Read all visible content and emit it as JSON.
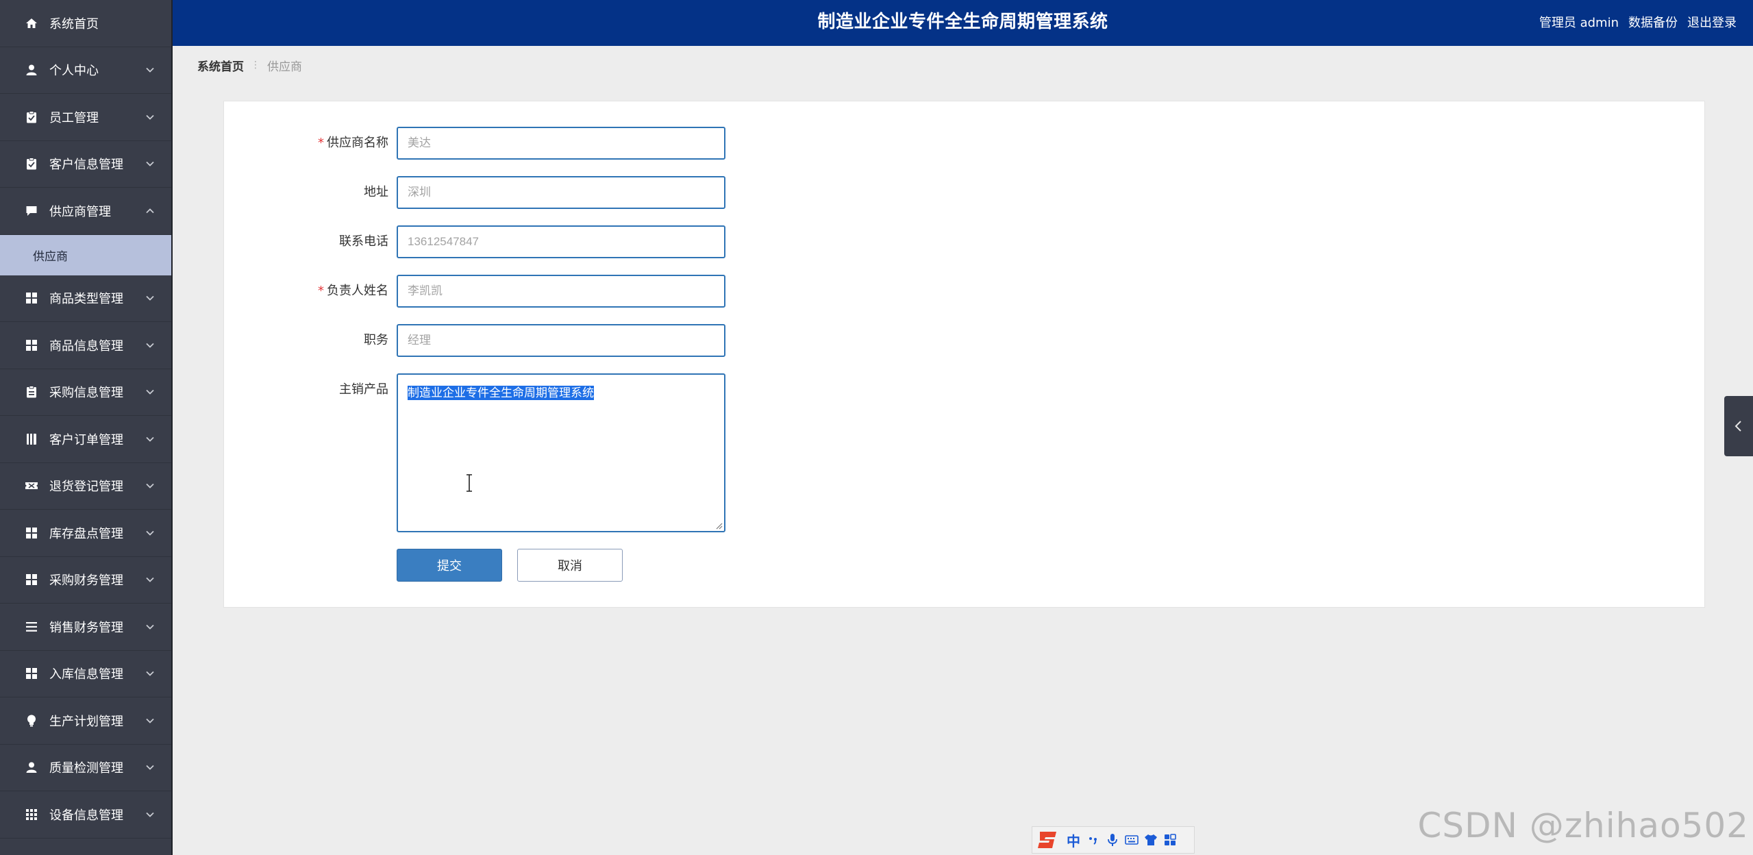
{
  "app": {
    "title": "制造业企业专件全生命周期管理系统"
  },
  "header": {
    "admin_label": "管理员 admin",
    "backup_label": "数据备份",
    "logout_label": "退出登录"
  },
  "sidebar": {
    "items": [
      {
        "label": "系统首页",
        "icon": "home-icon"
      },
      {
        "label": "个人中心",
        "icon": "user-icon"
      },
      {
        "label": "员工管理",
        "icon": "clipboard-icon"
      },
      {
        "label": "客户信息管理",
        "icon": "clipboard-icon"
      },
      {
        "label": "供应商管理",
        "icon": "chat-icon"
      },
      {
        "label": "商品类型管理",
        "icon": "grid-icon"
      },
      {
        "label": "商品信息管理",
        "icon": "grid-icon"
      },
      {
        "label": "采购信息管理",
        "icon": "clipboard-icon"
      },
      {
        "label": "客户订单管理",
        "icon": "book-icon"
      },
      {
        "label": "退货登记管理",
        "icon": "ticket-icon"
      },
      {
        "label": "库存盘点管理",
        "icon": "grid-icon"
      },
      {
        "label": "采购财务管理",
        "icon": "grid-icon"
      },
      {
        "label": "销售财务管理",
        "icon": "list-icon"
      },
      {
        "label": "入库信息管理",
        "icon": "grid-icon"
      },
      {
        "label": "生产计划管理",
        "icon": "bulb-icon"
      },
      {
        "label": "质量检测管理",
        "icon": "user-icon"
      },
      {
        "label": "设备信息管理",
        "icon": "apps-icon"
      }
    ],
    "sub_item": "供应商"
  },
  "breadcrumb": {
    "home": "系统首页",
    "current": "供应商"
  },
  "form": {
    "supplier_name": {
      "label": "供应商名称",
      "placeholder": "美达",
      "required": true
    },
    "address": {
      "label": "地址",
      "placeholder": "深圳"
    },
    "phone": {
      "label": "联系电话",
      "placeholder": "13612547847"
    },
    "manager": {
      "label": "负责人姓名",
      "placeholder": "李凯凯",
      "required": true
    },
    "position": {
      "label": "职务",
      "placeholder": "经理"
    },
    "products": {
      "label": "主销产品",
      "value": "制造业企业专件全生命周期管理系统"
    },
    "submit_label": "提交",
    "cancel_label": "取消",
    "required_mark": "*"
  },
  "ime": {
    "mode": "中"
  },
  "watermark": "CSDN @zhihao502",
  "colors": {
    "sidebar_bg": "#393d49",
    "topbar_bg": "#043287",
    "active_sub_bg": "#b6c0dc",
    "field_border": "#2f74b5",
    "submit_bg": "#3a7ec1",
    "required": "#e4393c"
  }
}
